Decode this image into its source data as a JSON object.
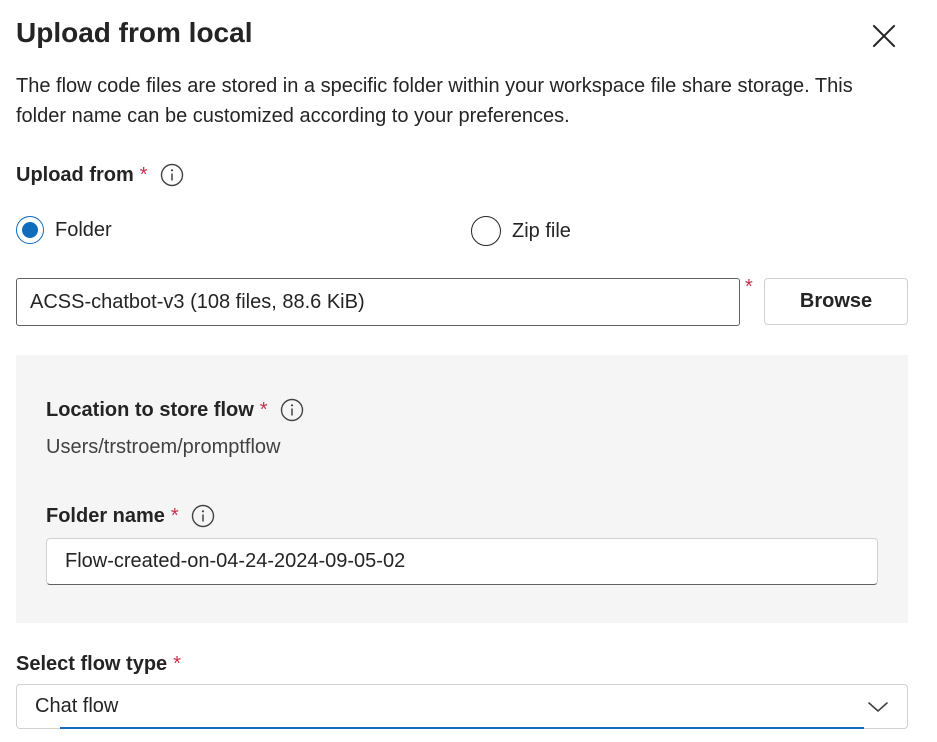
{
  "dialog": {
    "title": "Upload from local",
    "description": "The flow code files are stored in a specific folder within your workspace file share storage. This folder name can be customized according to your preferences."
  },
  "upload_from": {
    "label": "Upload from",
    "required_mark": "*",
    "options": [
      {
        "label": "Folder",
        "checked": true
      },
      {
        "label": "Zip file",
        "checked": false
      }
    ]
  },
  "path": {
    "value": "ACSS-chatbot-v3 (108 files, 88.6 KiB)",
    "required_mark": "*",
    "browse_label": "Browse"
  },
  "location": {
    "label": "Location to store flow",
    "required_mark": "*",
    "value": "Users/trstroem/promptflow"
  },
  "folder_name": {
    "label": "Folder name",
    "required_mark": "*",
    "value": "Flow-created-on-04-24-2024-09-05-02"
  },
  "flow_type": {
    "label": "Select flow type",
    "required_mark": "*",
    "selected": "Chat flow"
  },
  "colors": {
    "accent": "#0f6cbd",
    "required": "#c4314b",
    "panel": "#f5f5f5"
  },
  "icons": [
    "close-icon",
    "info-icon",
    "chevron-down-icon"
  ]
}
